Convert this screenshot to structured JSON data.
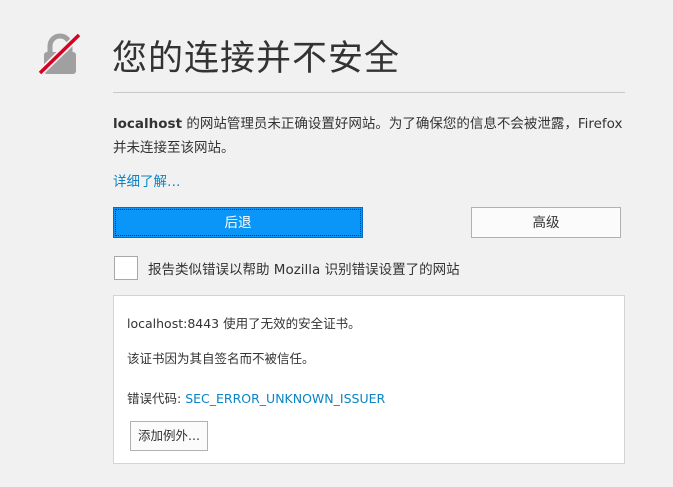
{
  "header": {
    "title": "您的连接并不安全"
  },
  "description": {
    "host": "localhost",
    "text_part1": " 的网站管理员未正确设置好网站。为了确保您的信息不会被泄露，Firefox 并未连接至该网站。"
  },
  "learn_more": {
    "label": "详细了解…"
  },
  "buttons": {
    "back_label": "后退",
    "advanced_label": "高级"
  },
  "report": {
    "label": "报告类似错误以帮助 Mozilla 识别错误设置了的网站",
    "checked": false
  },
  "advanced_panel": {
    "line1": "localhost:8443 使用了无效的安全证书。",
    "line2": "该证书因为其自签名而不被信任。",
    "error_code_label": "错误代码: ",
    "error_code": "SEC_ERROR_UNKNOWN_ISSUER",
    "add_exception_label": "添加例外..."
  },
  "colors": {
    "background": "#f1f1f1",
    "primary_button": "#0996f8",
    "link": "#0a84c4",
    "lock_icon": "#a0a0a0",
    "slash": "#d70022"
  },
  "icons": {
    "lock": "broken-lock-icon"
  }
}
